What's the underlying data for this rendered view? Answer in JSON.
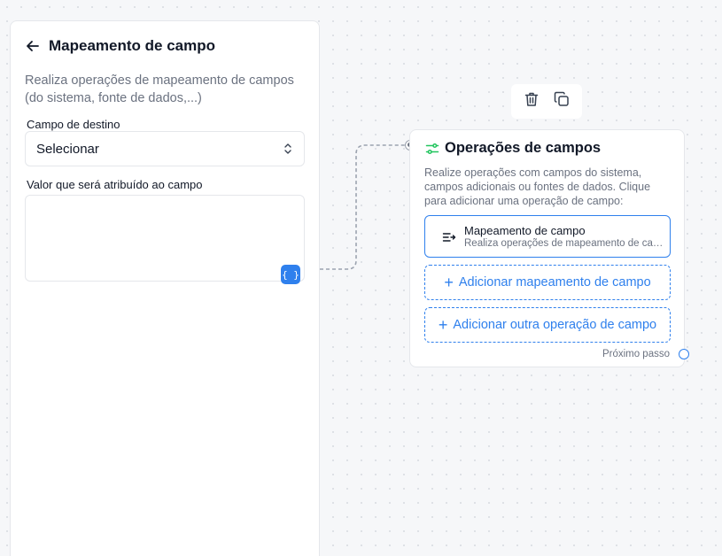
{
  "panel": {
    "title": "Mapeamento de campo",
    "description": "Realiza operações de mapeamento de campos (do sistema, fonte de dados,...)",
    "target_field_label": "Campo de destino",
    "target_field_value": "Selecionar",
    "value_label": "Valor que será atribuído ao campo",
    "value_text": "",
    "variable_button_label": "{ }"
  },
  "node": {
    "title": "Operações de campos",
    "description": "Realize operações com campos do sistema, campos adicionais ou fontes de dados. Clique para adicionar uma operação de campo:",
    "operation": {
      "title": "Mapeamento de campo",
      "subtitle": "Realiza operações de mapeamento de campos (do sistema, fonte de dados,...)"
    },
    "add_mapping_label": "Adicionar mapeamento de campo",
    "add_other_label": "Adicionar outra operação de campo",
    "next_step_label": "Próximo passo"
  },
  "colors": {
    "accent": "#2f80ed",
    "node_icon": "#22c55e",
    "muted_text": "#6b7280"
  },
  "icons": {
    "back": "arrow-left-icon",
    "select": "chevron-up-down-icon",
    "delete": "trash-icon",
    "duplicate": "copy-icon",
    "node": "sliders-icon",
    "operation": "mapping-icon",
    "plus": "plus-icon"
  }
}
